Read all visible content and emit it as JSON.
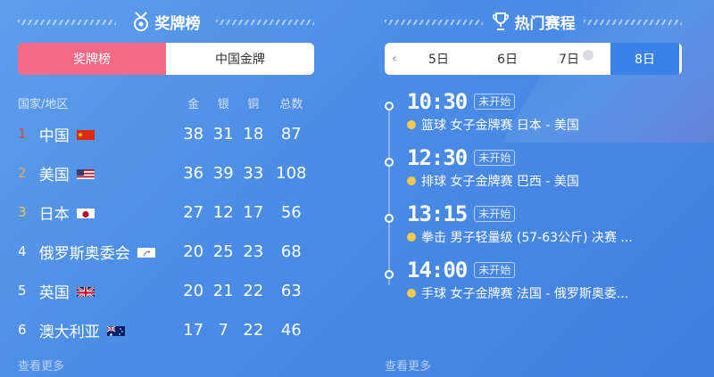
{
  "medals": {
    "title": "奖牌榜",
    "tabs": [
      {
        "label": "奖牌榜",
        "active": true
      },
      {
        "label": "中国金牌",
        "active": false
      }
    ],
    "headers": {
      "country": "国家/地区",
      "gold": "金",
      "silver": "银",
      "bronze": "铜",
      "total": "总数"
    },
    "rows": [
      {
        "rank": "1",
        "rank_color": "#e8453c",
        "country": "中国",
        "flag": "cn",
        "gold": "38",
        "silver": "31",
        "bronze": "18",
        "total": "87"
      },
      {
        "rank": "2",
        "rank_color": "#f0a25a",
        "country": "美国",
        "flag": "us",
        "gold": "36",
        "silver": "39",
        "bronze": "33",
        "total": "108"
      },
      {
        "rank": "3",
        "rank_color": "#f5c04a",
        "country": "日本",
        "flag": "jp",
        "gold": "27",
        "silver": "12",
        "bronze": "17",
        "total": "56"
      },
      {
        "rank": "4",
        "rank_color": "#ffffff",
        "country": "俄罗斯奥委会",
        "flag": "roc",
        "gold": "20",
        "silver": "25",
        "bronze": "23",
        "total": "68"
      },
      {
        "rank": "5",
        "rank_color": "#ffffff",
        "country": "英国",
        "flag": "gb",
        "gold": "20",
        "silver": "21",
        "bronze": "22",
        "total": "63"
      },
      {
        "rank": "6",
        "rank_color": "#ffffff",
        "country": "澳大利亚",
        "flag": "au",
        "gold": "17",
        "silver": "7",
        "bronze": "22",
        "total": "46"
      }
    ],
    "more": "查看更多"
  },
  "schedule": {
    "title": "热门赛程",
    "dates": [
      {
        "label": "5日",
        "active": false,
        "hint": false
      },
      {
        "label": "6日",
        "active": false,
        "hint": false
      },
      {
        "label": "7日",
        "active": false,
        "hint": true
      },
      {
        "label": "8日",
        "active": true,
        "hint": false
      }
    ],
    "events": [
      {
        "time": "10:30",
        "status": "未开始",
        "desc": "篮球 女子金牌赛 日本 - 美国"
      },
      {
        "time": "12:30",
        "status": "未开始",
        "desc": "排球 女子金牌赛 巴西 - 美国"
      },
      {
        "time": "13:15",
        "status": "未开始",
        "desc": "拳击 男子轻量级 (57-63公斤) 决赛 ..."
      },
      {
        "time": "14:00",
        "status": "未开始",
        "desc": "手球 女子金牌赛 法国 - 俄罗斯奥委..."
      }
    ],
    "more": "查看更多"
  },
  "colors": {
    "accent_pink": "#f36a86",
    "accent_blue": "#3b82e8",
    "event_dot": "#f7c84a"
  }
}
